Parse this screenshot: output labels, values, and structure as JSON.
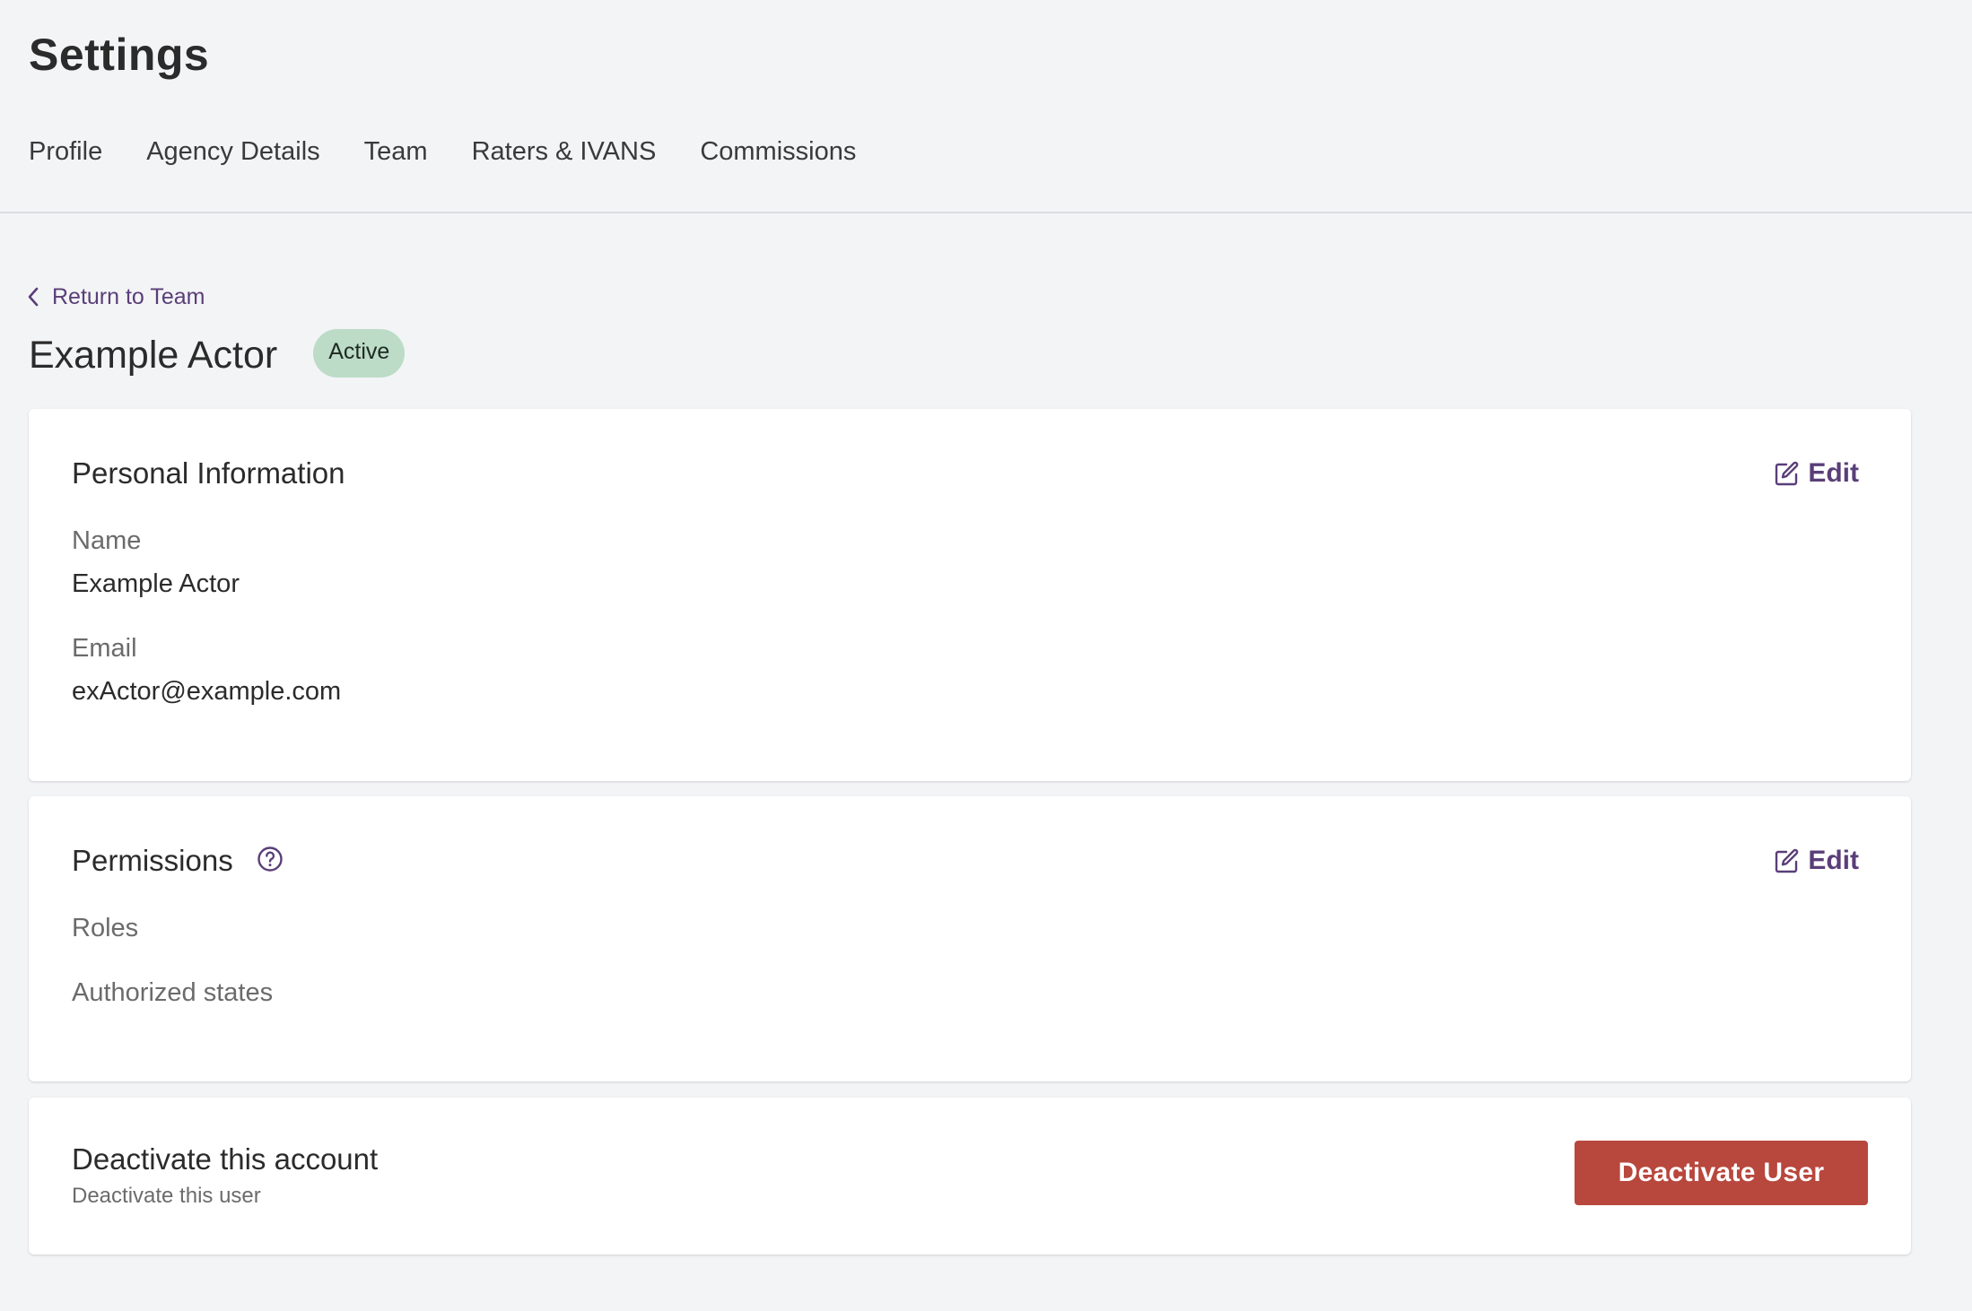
{
  "page": {
    "title": "Settings"
  },
  "tabs": [
    {
      "label": "Profile"
    },
    {
      "label": "Agency Details"
    },
    {
      "label": "Team"
    },
    {
      "label": "Raters & IVANS"
    },
    {
      "label": "Commissions"
    }
  ],
  "back_link": {
    "label": "Return to Team",
    "icon": "chevron-left-icon"
  },
  "user": {
    "name": "Example Actor",
    "status": "Active"
  },
  "personal_info": {
    "heading": "Personal Information",
    "edit_label": "Edit",
    "fields": [
      {
        "label": "Name",
        "value": "Example Actor"
      },
      {
        "label": "Email",
        "value": "exActor@example.com"
      }
    ]
  },
  "permissions": {
    "heading": "Permissions",
    "help_icon": "question-circle-icon",
    "edit_label": "Edit",
    "roles_label": "Roles",
    "states_label": "Authorized states"
  },
  "deactivate": {
    "title": "Deactivate this account",
    "subtitle": "Deactivate this user",
    "button_label": "Deactivate User"
  },
  "colors": {
    "background": "#f3f4f6",
    "accent": "#5a3e78",
    "status_active_bg": "#bcdcc7",
    "danger": "#b8473d"
  }
}
